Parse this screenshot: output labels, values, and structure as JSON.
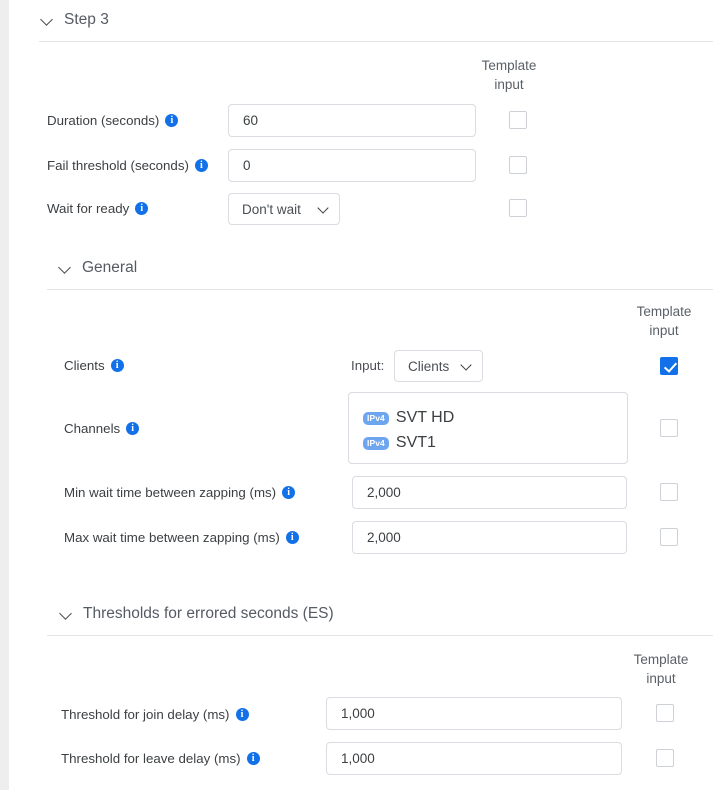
{
  "sections": [
    {
      "id": "step3",
      "title": "Step 3",
      "chevron_icon": "chevron-down-icon",
      "template_input_header": {
        "line1": "Template",
        "line2": "input"
      },
      "rows": [
        {
          "label": "Duration (seconds)",
          "info_icon": "info-icon",
          "control": "text",
          "value": "60",
          "template_input": false
        },
        {
          "label": "Fail threshold (seconds)",
          "info_icon": "info-icon",
          "control": "text",
          "value": "0",
          "template_input": false
        },
        {
          "label": "Wait for ready",
          "info_icon": "info-icon",
          "control": "select",
          "value": "Don't wait",
          "template_input": false
        }
      ]
    },
    {
      "id": "general",
      "title": "General",
      "chevron_icon": "chevron-down-icon",
      "template_input_header": {
        "line1": "Template",
        "line2": "input"
      },
      "rows": [
        {
          "label": "Clients",
          "info_icon": "info-icon",
          "control": "select",
          "prefix_label": "Input:",
          "value": "Clients",
          "template_input": true
        },
        {
          "label": "Channels",
          "info_icon": "info-icon",
          "control": "listbox",
          "items": [
            {
              "badge": "IPv4",
              "name": "SVT HD"
            },
            {
              "badge": "IPv4",
              "name": "SVT1"
            }
          ],
          "template_input": false
        },
        {
          "label": "Min wait time between zapping (ms)",
          "info_icon": "info-icon",
          "control": "text",
          "value": "2,000",
          "template_input": false
        },
        {
          "label": "Max wait time between zapping (ms)",
          "info_icon": "info-icon",
          "control": "text",
          "value": "2,000",
          "template_input": false
        }
      ]
    },
    {
      "id": "thresholds",
      "title": "Thresholds for errored seconds (ES)",
      "chevron_icon": "chevron-down-icon",
      "template_input_header": {
        "line1": "Template",
        "line2": "input"
      },
      "rows": [
        {
          "label": "Threshold for join delay (ms)",
          "info_icon": "info-icon",
          "control": "text",
          "value": "1,000",
          "template_input": false
        },
        {
          "label": "Threshold for leave delay (ms)",
          "info_icon": "info-icon",
          "control": "text",
          "value": "1,000",
          "template_input": false
        }
      ]
    }
  ],
  "colors": {
    "accent_blue": "#1271e8",
    "badge_blue": "#6ea5ef",
    "text": "#3c4043",
    "muted_text": "#5a6068",
    "border": "#d9dce0",
    "divider": "#e2e4e7",
    "page_background": "#eeeeee",
    "card_background": "#ffffff"
  },
  "icons": {
    "info": "i",
    "chevron_down": "chevron-down-icon",
    "check": "checkmark-icon"
  }
}
